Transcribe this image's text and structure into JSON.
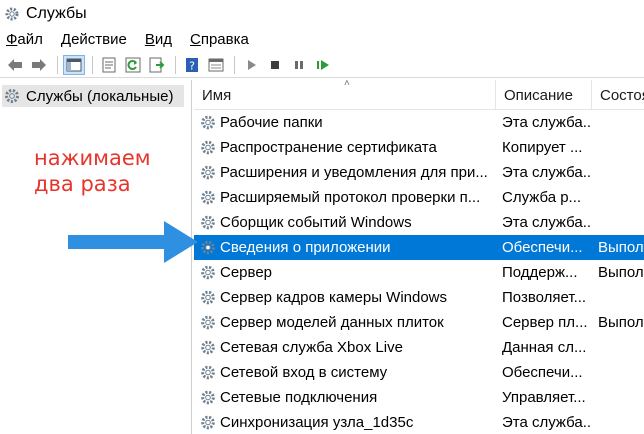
{
  "window": {
    "title": "Службы"
  },
  "menu": {
    "items": [
      {
        "accel": "Ф",
        "rest": "айл"
      },
      {
        "accel": "Д",
        "rest": "ействие"
      },
      {
        "accel": "В",
        "rest": "ид"
      },
      {
        "accel": "С",
        "rest": "правка"
      }
    ]
  },
  "toolbar": {
    "icons": [
      "back-icon",
      "forward-icon",
      "show-hide-tree-icon",
      "properties-icon",
      "refresh-icon",
      "export-list-icon",
      "help-icon",
      "view-icon",
      "play-icon",
      "stop-icon",
      "pause-icon",
      "restart-icon"
    ]
  },
  "tree": {
    "root_label": "Службы (локальные)"
  },
  "annotation": {
    "line1": "нажимаем",
    "line2": "два раза"
  },
  "table": {
    "headers": {
      "name": "Имя",
      "description": "Описание",
      "state": "Состоя"
    },
    "rows": [
      {
        "name": "Рабочие папки",
        "description": "Эта служба...",
        "state": ""
      },
      {
        "name": "Распространение сертификата",
        "description": "Копирует ...",
        "state": ""
      },
      {
        "name": "Расширения и уведомления для при...",
        "description": "Эта служба...",
        "state": ""
      },
      {
        "name": "Расширяемый протокол проверки п...",
        "description": "Служба р...",
        "state": ""
      },
      {
        "name": "Сборщик событий Windows",
        "description": "Эта служба...",
        "state": ""
      },
      {
        "name": "Сведения о приложении",
        "description": "Обеспечи...",
        "state": "Выпол"
      },
      {
        "name": "Сервер",
        "description": "Поддерж...",
        "state": "Выпол"
      },
      {
        "name": "Сервер кадров камеры Windows",
        "description": "Позволяет...",
        "state": ""
      },
      {
        "name": "Сервер моделей данных плиток",
        "description": "Сервер пл...",
        "state": "Выпол"
      },
      {
        "name": "Сетевая служба Xbox Live",
        "description": "Данная сл...",
        "state": ""
      },
      {
        "name": "Сетевой вход в систему",
        "description": "Обеспечи...",
        "state": ""
      },
      {
        "name": "Сетевые подключения",
        "description": "Управляет...",
        "state": ""
      },
      {
        "name": "Синхронизация узла_1d35c",
        "description": "Эта служба...",
        "state": ""
      }
    ],
    "selected_row": 5
  },
  "colors": {
    "selection": "#0078d7",
    "annotation": "#e8352b",
    "arrow": "#2f8fe0"
  }
}
